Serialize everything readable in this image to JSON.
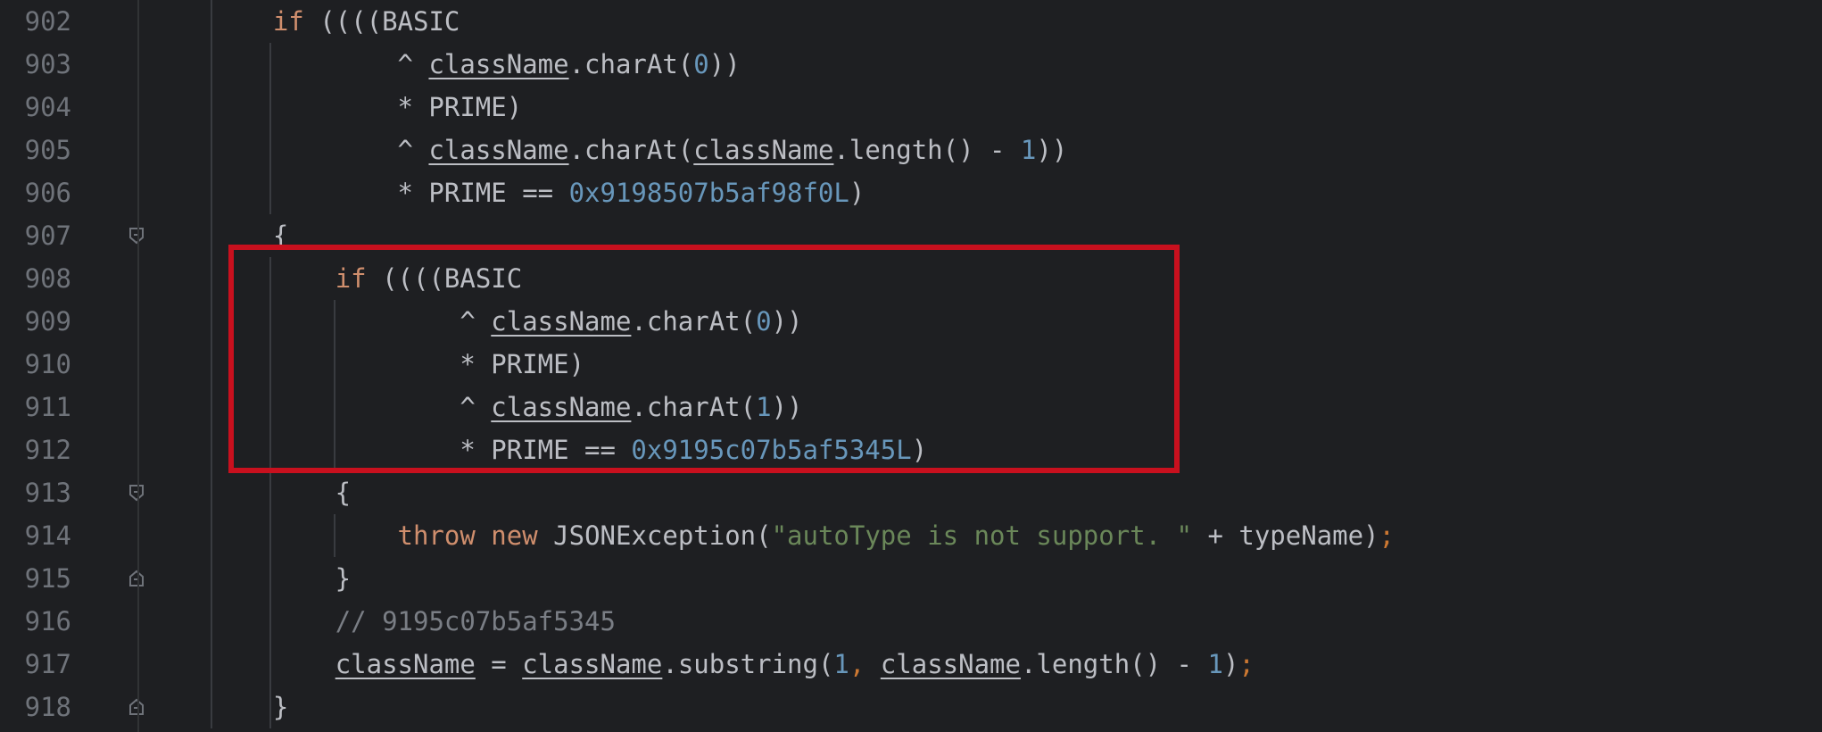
{
  "editor": {
    "line_numbers": [
      "902",
      "903",
      "904",
      "905",
      "906",
      "907",
      "908",
      "909",
      "910",
      "911",
      "912",
      "913",
      "914",
      "915",
      "916",
      "917",
      "918"
    ],
    "lines": [
      [
        {
          "t": "    ",
          "c": ""
        },
        {
          "t": "if",
          "c": "kw"
        },
        {
          "t": " ((((BASIC",
          "c": ""
        }
      ],
      [
        {
          "t": "            ^ ",
          "c": ""
        },
        {
          "t": "className",
          "c": "u"
        },
        {
          "t": ".charAt(",
          "c": ""
        },
        {
          "t": "0",
          "c": "num"
        },
        {
          "t": "))",
          "c": ""
        }
      ],
      [
        {
          "t": "            * PRIME)",
          "c": ""
        }
      ],
      [
        {
          "t": "            ^ ",
          "c": ""
        },
        {
          "t": "className",
          "c": "u"
        },
        {
          "t": ".charAt(",
          "c": ""
        },
        {
          "t": "className",
          "c": "u"
        },
        {
          "t": ".length() - ",
          "c": ""
        },
        {
          "t": "1",
          "c": "num"
        },
        {
          "t": "))",
          "c": ""
        }
      ],
      [
        {
          "t": "            * PRIME == ",
          "c": ""
        },
        {
          "t": "0x9198507b5af98f0L",
          "c": "num"
        },
        {
          "t": ")",
          "c": ""
        }
      ],
      [
        {
          "t": "    {",
          "c": ""
        }
      ],
      [
        {
          "t": "        ",
          "c": ""
        },
        {
          "t": "if",
          "c": "kw"
        },
        {
          "t": " ((((BASIC",
          "c": ""
        }
      ],
      [
        {
          "t": "                ^ ",
          "c": ""
        },
        {
          "t": "className",
          "c": "u"
        },
        {
          "t": ".charAt(",
          "c": ""
        },
        {
          "t": "0",
          "c": "num"
        },
        {
          "t": "))",
          "c": ""
        }
      ],
      [
        {
          "t": "                * PRIME)",
          "c": ""
        }
      ],
      [
        {
          "t": "                ^ ",
          "c": ""
        },
        {
          "t": "className",
          "c": "u"
        },
        {
          "t": ".charAt(",
          "c": ""
        },
        {
          "t": "1",
          "c": "num"
        },
        {
          "t": "))",
          "c": ""
        }
      ],
      [
        {
          "t": "                * PRIME == ",
          "c": ""
        },
        {
          "t": "0x9195c07b5af5345L",
          "c": "num"
        },
        {
          "t": ")",
          "c": ""
        }
      ],
      [
        {
          "t": "        {",
          "c": ""
        }
      ],
      [
        {
          "t": "            ",
          "c": ""
        },
        {
          "t": "throw",
          "c": "kw"
        },
        {
          "t": " ",
          "c": ""
        },
        {
          "t": "new",
          "c": "kw"
        },
        {
          "t": " JSONException(",
          "c": ""
        },
        {
          "t": "\"autoType is not support. \"",
          "c": "str"
        },
        {
          "t": " + typeName)",
          "c": ""
        },
        {
          "t": ";",
          "c": "punct"
        }
      ],
      [
        {
          "t": "        }",
          "c": ""
        }
      ],
      [
        {
          "t": "        ",
          "c": ""
        },
        {
          "t": "// 9195c07b5af5345",
          "c": "cm"
        }
      ],
      [
        {
          "t": "        ",
          "c": ""
        },
        {
          "t": "className",
          "c": "u"
        },
        {
          "t": " = ",
          "c": ""
        },
        {
          "t": "className",
          "c": "u"
        },
        {
          "t": ".substring(",
          "c": ""
        },
        {
          "t": "1",
          "c": "num"
        },
        {
          "t": ", ",
          "c": "punct"
        },
        {
          "t": "className",
          "c": "u"
        },
        {
          "t": ".length() - ",
          "c": ""
        },
        {
          "t": "1",
          "c": "num"
        },
        {
          "t": ")",
          "c": ""
        },
        {
          "t": ";",
          "c": "punct"
        }
      ],
      [
        {
          "t": "    }",
          "c": ""
        }
      ]
    ],
    "fold_markers": [
      {
        "line": "907",
        "type": "open"
      },
      {
        "line": "913",
        "type": "open"
      },
      {
        "line": "915",
        "type": "close"
      },
      {
        "line": "918",
        "type": "close"
      }
    ],
    "highlight": {
      "from_line": "908",
      "to_line": "912",
      "color": "#c8101e"
    },
    "colors": {
      "background": "#1e1f22",
      "text": "#bcbec4",
      "keyword": "#cf8e6d",
      "number": "#6897bb",
      "string": "#6a8759",
      "comment": "#7a7e85",
      "line_number": "#6f737a"
    }
  }
}
